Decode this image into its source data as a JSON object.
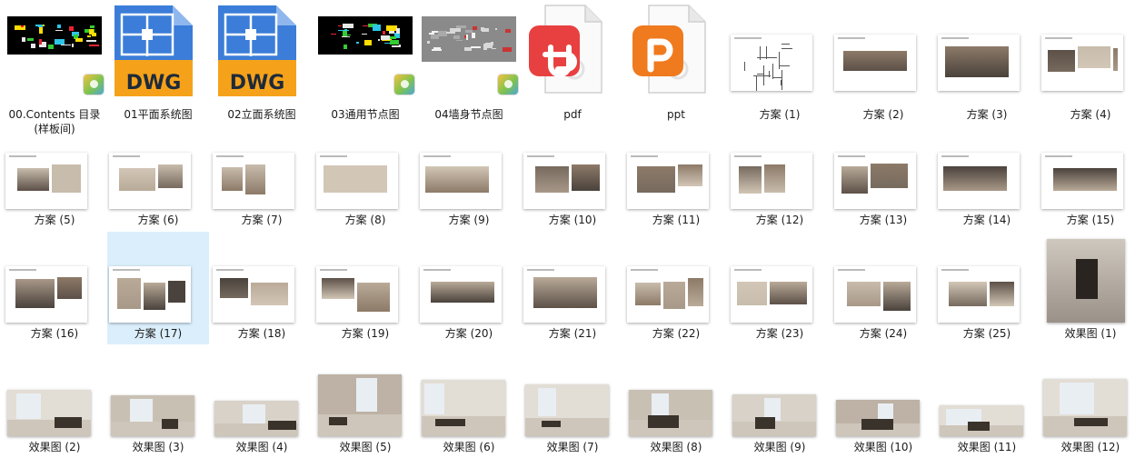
{
  "files": [
    {
      "name": "00.Contents 目录(样板间)",
      "label1": "00.Contents 目录",
      "label2": "(样板间)",
      "kind": "cad",
      "icon": "cad-image-icon"
    },
    {
      "name": "01平面系统图",
      "label1": "01平面系统图",
      "kind": "dwg",
      "icon": "dwg-file-icon",
      "badge_text": "DWG"
    },
    {
      "name": "02立面系统图",
      "label1": "02立面系统图",
      "kind": "dwg",
      "icon": "dwg-file-icon",
      "badge_text": "DWG"
    },
    {
      "name": "03通用节点图",
      "label1": "03通用节点图",
      "kind": "cad",
      "icon": "cad-image-icon"
    },
    {
      "name": "04墙身节点图",
      "label1": "04墙身节点图",
      "kind": "cad-grey",
      "icon": "cad-image-icon"
    },
    {
      "name": "pdf",
      "label1": "pdf",
      "kind": "pdf",
      "icon": "pdf-file-icon"
    },
    {
      "name": "ppt",
      "label1": "ppt",
      "kind": "ppt",
      "icon": "ppt-file-icon"
    },
    {
      "name": "方案 (1)",
      "label1": "方案 (1)",
      "kind": "plan"
    },
    {
      "name": "方案 (2)",
      "label1": "方案 (2)",
      "kind": "sheet"
    },
    {
      "name": "方案 (3)",
      "label1": "方案 (3)",
      "kind": "sheet"
    },
    {
      "name": "方案 (4)",
      "label1": "方案 (4)",
      "kind": "sheet"
    },
    {
      "name": "方案 (5)",
      "label1": "方案 (5)",
      "kind": "sheet"
    },
    {
      "name": "方案 (6)",
      "label1": "方案 (6)",
      "kind": "sheet"
    },
    {
      "name": "方案 (7)",
      "label1": "方案 (7)",
      "kind": "sheet"
    },
    {
      "name": "方案 (8)",
      "label1": "方案 (8)",
      "kind": "sheet"
    },
    {
      "name": "方案 (9)",
      "label1": "方案 (9)",
      "kind": "sheet"
    },
    {
      "name": "方案 (10)",
      "label1": "方案 (10)",
      "kind": "sheet"
    },
    {
      "name": "方案 (11)",
      "label1": "方案 (11)",
      "kind": "sheet"
    },
    {
      "name": "方案 (12)",
      "label1": "方案 (12)",
      "kind": "sheet"
    },
    {
      "name": "方案 (13)",
      "label1": "方案 (13)",
      "kind": "sheet"
    },
    {
      "name": "方案 (14)",
      "label1": "方案 (14)",
      "kind": "sheet"
    },
    {
      "name": "方案 (15)",
      "label1": "方案 (15)",
      "kind": "sheet"
    },
    {
      "name": "方案 (16)",
      "label1": "方案 (16)",
      "kind": "sheet"
    },
    {
      "name": "方案 (17)",
      "label1": "方案 (17)",
      "kind": "sheet",
      "selected": true
    },
    {
      "name": "方案 (18)",
      "label1": "方案 (18)",
      "kind": "sheet"
    },
    {
      "name": "方案 (19)",
      "label1": "方案 (19)",
      "kind": "sheet"
    },
    {
      "name": "方案 (20)",
      "label1": "方案 (20)",
      "kind": "sheet"
    },
    {
      "name": "方案 (21)",
      "label1": "方案 (21)",
      "kind": "sheet"
    },
    {
      "name": "方案 (22)",
      "label1": "方案 (22)",
      "kind": "sheet"
    },
    {
      "name": "方案 (23)",
      "label1": "方案 (23)",
      "kind": "sheet"
    },
    {
      "name": "方案 (24)",
      "label1": "方案 (24)",
      "kind": "sheet"
    },
    {
      "name": "方案 (25)",
      "label1": "方案 (25)",
      "kind": "sheet"
    },
    {
      "name": "效果图 (1)",
      "label1": "效果图 (1)",
      "kind": "render-tall"
    },
    {
      "name": "效果图 (2)",
      "label1": "效果图 (2)",
      "kind": "render"
    },
    {
      "name": "效果图 (3)",
      "label1": "效果图 (3)",
      "kind": "render"
    },
    {
      "name": "效果图 (4)",
      "label1": "效果图 (4)",
      "kind": "render"
    },
    {
      "name": "效果图 (5)",
      "label1": "效果图 (5)",
      "kind": "render"
    },
    {
      "name": "效果图 (6)",
      "label1": "效果图 (6)",
      "kind": "render"
    },
    {
      "name": "效果图 (7)",
      "label1": "效果图 (7)",
      "kind": "render"
    },
    {
      "name": "效果图 (8)",
      "label1": "效果图 (8)",
      "kind": "render"
    },
    {
      "name": "效果图 (9)",
      "label1": "效果图 (9)",
      "kind": "render"
    },
    {
      "name": "效果图 (10)",
      "label1": "效果图 (10)",
      "kind": "render"
    },
    {
      "name": "效果图 (11)",
      "label1": "效果图 (11)",
      "kind": "render"
    },
    {
      "name": "效果图 (12)",
      "label1": "效果图 (12)",
      "kind": "render"
    }
  ],
  "colors": {
    "selection": "#dbeefc",
    "dwg_blue": "#3b7dd8",
    "dwg_orange": "#f5a21a",
    "pdf_red": "#e84040",
    "ppt_orange": "#f07a1e",
    "cad_bg": "#000000"
  }
}
